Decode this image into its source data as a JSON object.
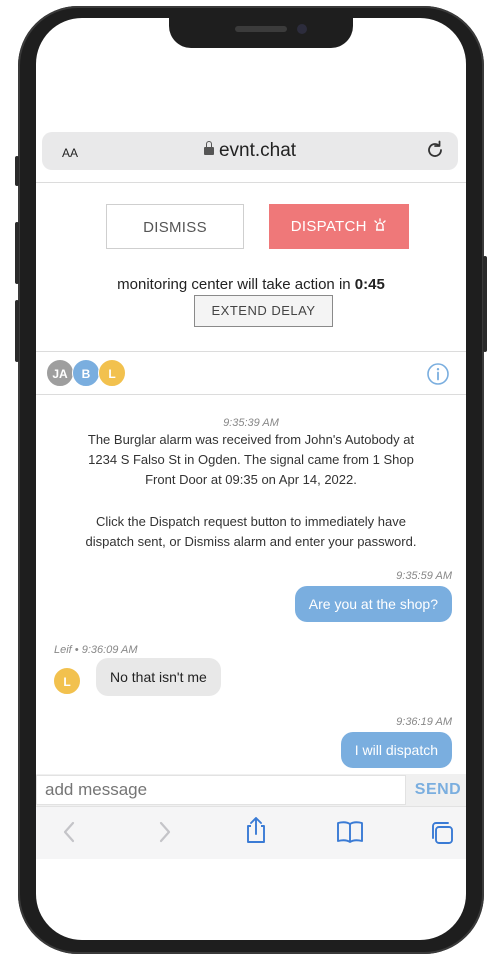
{
  "browser": {
    "text_size_label": "AA",
    "host": "evnt.chat"
  },
  "actions": {
    "dismiss_label": "DISMISS",
    "dispatch_label": "DISPATCH",
    "countdown_prefix": "monitoring center will take action in",
    "countdown_value": "0:45",
    "extend_label": "EXTEND DELAY"
  },
  "participants": [
    {
      "initials": "JA",
      "color": "#9e9e9e"
    },
    {
      "initials": "B",
      "color": "#7aaedf"
    },
    {
      "initials": "L",
      "color": "#f2c14e"
    }
  ],
  "chat": {
    "system_time": "9:35:39 AM",
    "system_lines": [
      "The Burglar alarm was received from John's Autobody at",
      "1234 S Falso St  in Ogden. The signal came from 1 Shop",
      "Front Door at 09:35 on Apr 14, 2022.",
      "Click the Dispatch request button to immediately have",
      "dispatch sent, or Dismiss alarm and enter your password."
    ],
    "messages": [
      {
        "time": "9:35:59 AM",
        "text": "Are you at the shop?",
        "from": "me"
      },
      {
        "sender": "Leif • 9:36:09 AM",
        "initial": "L",
        "text": "No that isn't me",
        "from": "other"
      },
      {
        "time": "9:36:19 AM",
        "text": "I will dispatch",
        "from": "me"
      }
    ]
  },
  "composer": {
    "placeholder": "add message",
    "send_label": "SEND"
  },
  "colors": {
    "dispatch": "#ef7879",
    "accent": "#7aaedf"
  }
}
